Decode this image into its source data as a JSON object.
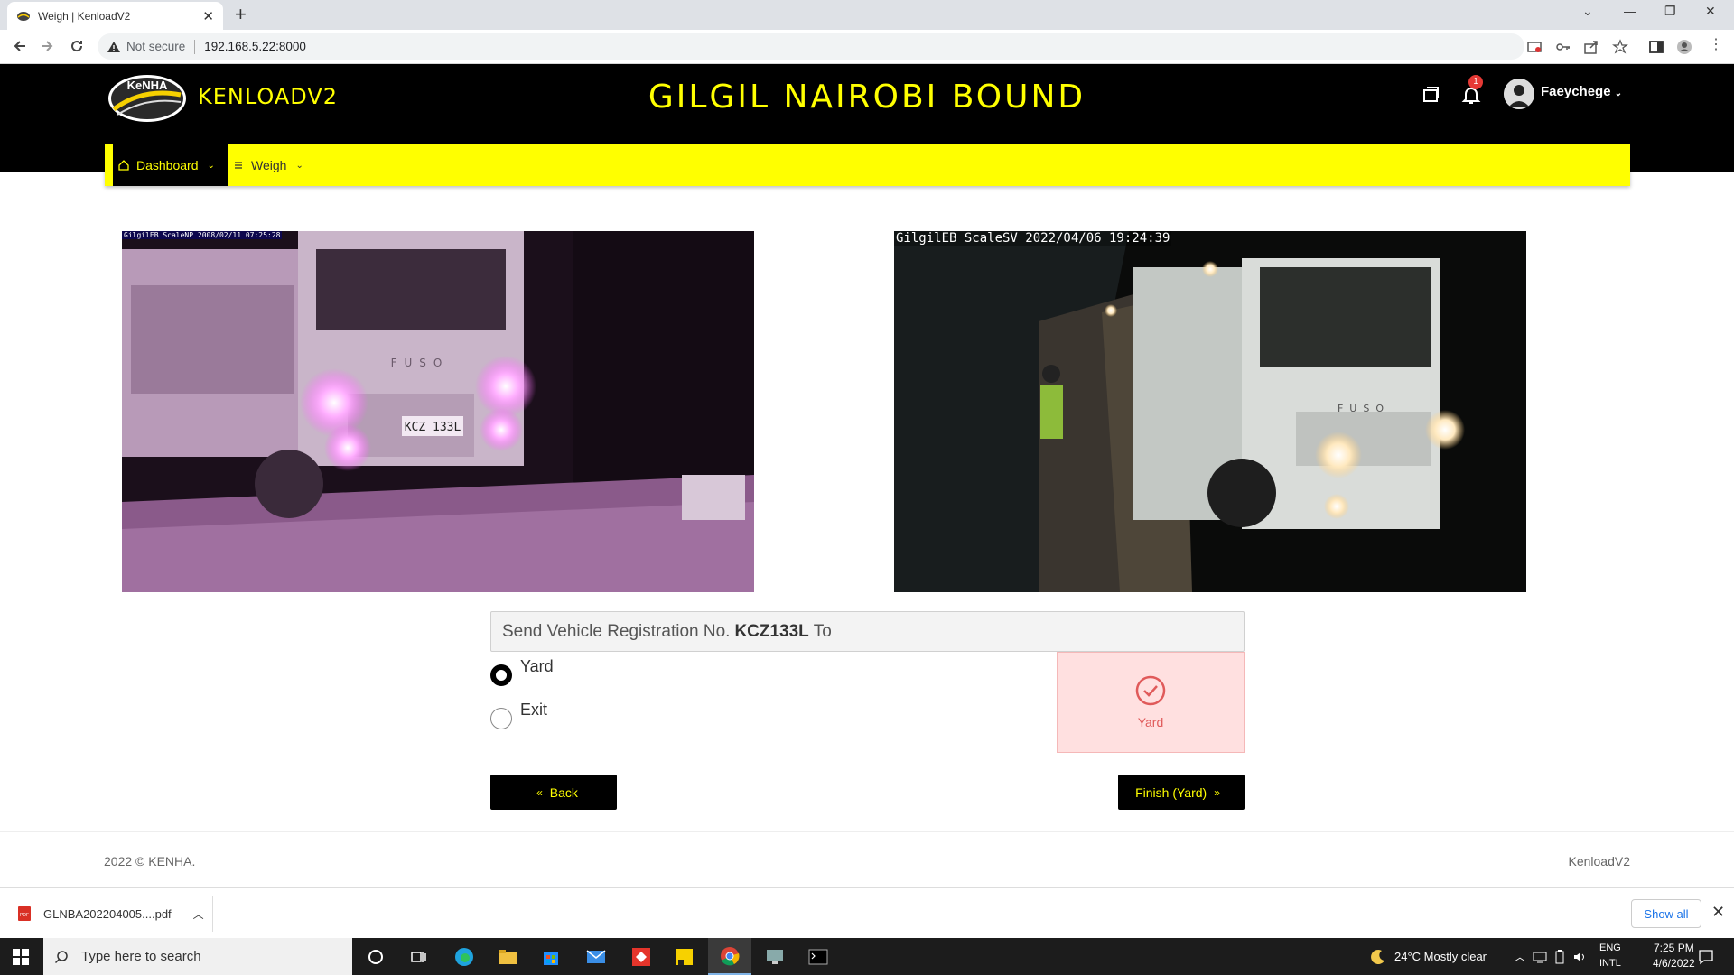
{
  "browser": {
    "tab_title": "Weigh | KenloadV2",
    "security_label": "Not secure",
    "url": "192.168.5.22:8000"
  },
  "header": {
    "logo_text": "KeNHA",
    "brand": "KENLOADV2",
    "station": "GILGIL NAIROBI BOUND",
    "notification_count": "1",
    "username": "Faeychege"
  },
  "nav": {
    "items": [
      {
        "label": "Dashboard",
        "icon": "home-icon",
        "active": true
      },
      {
        "label": "Weigh",
        "icon": "list-icon",
        "active": false
      }
    ]
  },
  "cameras": {
    "left": {
      "stamp": "GilgilEB ScaleNP 2008/02/11 07:25:28"
    },
    "right": {
      "stamp": "GilgilEB  ScaleSV  2022/04/06  19:24:39"
    },
    "plate_left": "KCZ 133L",
    "truck_brand": "FUSO"
  },
  "send": {
    "prefix": "Send Vehicle Registration No.",
    "reg_no": "KCZ133L",
    "suffix": "To",
    "options": [
      {
        "label": "Yard",
        "checked": true
      },
      {
        "label": "Exit",
        "checked": false
      }
    ],
    "selected_card": "Yard"
  },
  "buttons": {
    "back": "Back",
    "finish": "Finish (Yard)"
  },
  "footer": {
    "copyright": "2022 © KENHA.",
    "app": "KenloadV2"
  },
  "downloads": {
    "file": "GLNBA202204005....pdf",
    "show_all": "Show all"
  },
  "taskbar": {
    "search_placeholder": "Type here to search",
    "weather": "24°C  Mostly clear",
    "lang1": "ENG",
    "lang2": "INTL",
    "time": "7:25 PM",
    "date": "4/6/2022"
  },
  "colors": {
    "accent_yellow": "#ffff00",
    "header_bg": "#000000",
    "yard_card_bg": "#ffe0e0",
    "yard_card_fg": "#e05a5a"
  }
}
